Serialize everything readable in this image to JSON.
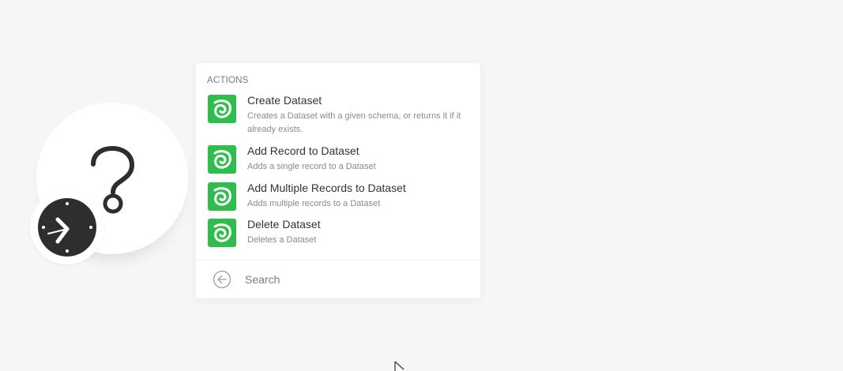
{
  "colors": {
    "background": "#f6f6f6",
    "app_icon": "#2fbd4b",
    "clock": "#2e2e2e",
    "question_mark": "#2e2e2e"
  },
  "module": {
    "icon": "question-mark-icon",
    "badge_icon": "clock-icon"
  },
  "panel": {
    "section_title": "ACTIONS",
    "actions": [
      {
        "label": "Create Dataset",
        "description": "Creates a Dataset with a given schema, or returns it if it already exists.",
        "icon": "dataset-app-icon"
      },
      {
        "label": "Add Record to Dataset",
        "description": "Adds a single record to a Dataset",
        "icon": "dataset-app-icon"
      },
      {
        "label": "Add Multiple Records to Dataset",
        "description": "Adds multiple records to a Dataset",
        "icon": "dataset-app-icon"
      },
      {
        "label": "Delete Dataset",
        "description": "Deletes a Dataset",
        "icon": "dataset-app-icon"
      }
    ],
    "search": {
      "placeholder": "Search",
      "value": "",
      "back_icon": "arrow-left-circle-icon"
    }
  }
}
